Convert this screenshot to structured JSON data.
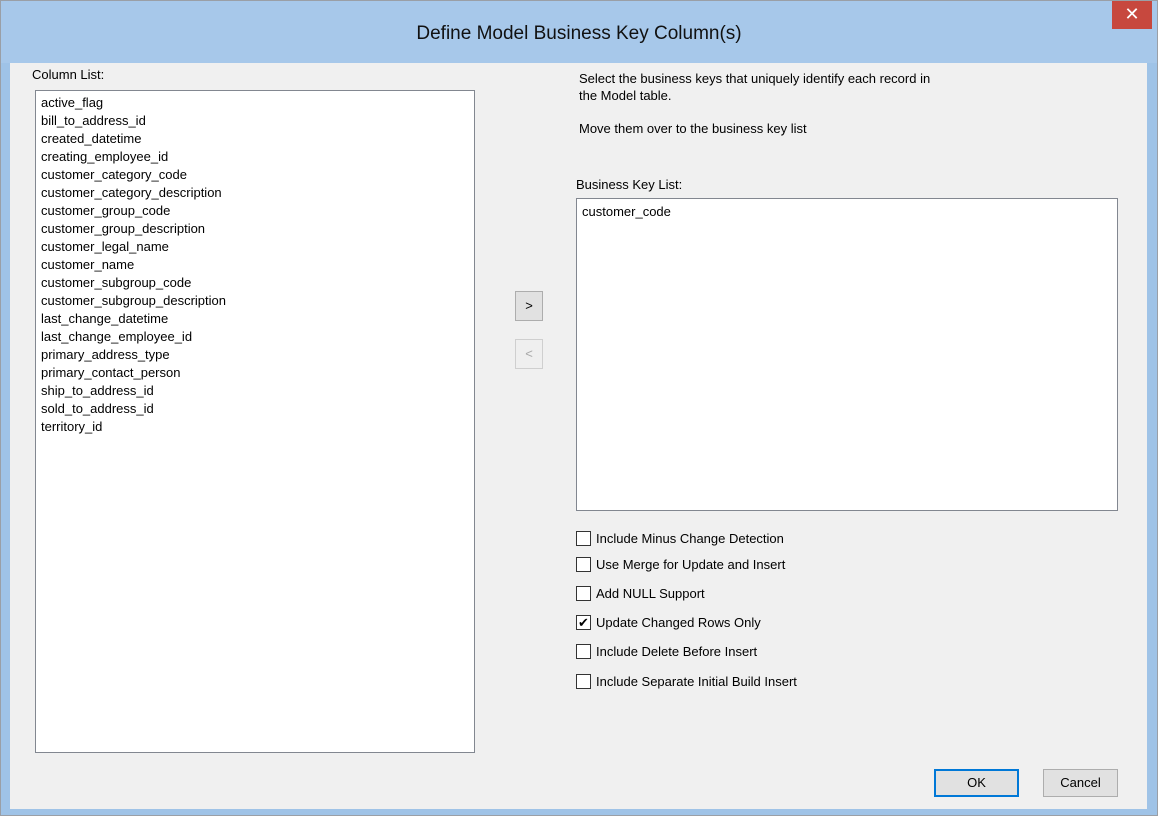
{
  "window": {
    "title": "Define Model Business Key Column(s)",
    "close_glyph": "✕"
  },
  "column_list": {
    "label": "Column List:",
    "items": [
      "active_flag",
      "bill_to_address_id",
      "created_datetime",
      "creating_employee_id",
      "customer_category_code",
      "customer_category_description",
      "customer_group_code",
      "customer_group_description",
      "customer_legal_name",
      "customer_name",
      "customer_subgroup_code",
      "customer_subgroup_description",
      "last_change_datetime",
      "last_change_employee_id",
      "primary_address_type",
      "primary_contact_person",
      "ship_to_address_id",
      "sold_to_address_id",
      "territory_id"
    ]
  },
  "move_buttons": {
    "add_label": ">",
    "remove_label": "<"
  },
  "instructions": {
    "line1": "Select the business keys that uniquely identify each record in",
    "line2": "the Model table.",
    "line3": "Move them over to the business key list"
  },
  "business_key_list": {
    "label": "Business Key List:",
    "items": [
      "customer_code"
    ]
  },
  "options": [
    {
      "label": "Include Minus Change Detection",
      "checked": false
    },
    {
      "label": "Use Merge for Update and Insert",
      "checked": false
    },
    {
      "label": "Add NULL Support",
      "checked": false
    },
    {
      "label": "Update Changed Rows Only",
      "checked": true
    },
    {
      "label": "Include Delete Before Insert",
      "checked": false
    },
    {
      "label": "Include Separate Initial Build Insert",
      "checked": false
    }
  ],
  "buttons": {
    "ok_label": "OK",
    "cancel_label": "Cancel"
  },
  "check_glyph": "✔"
}
